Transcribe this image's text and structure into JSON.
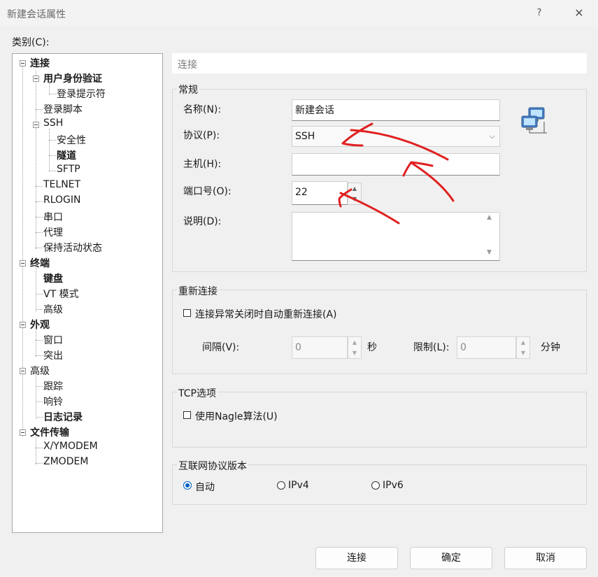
{
  "window": {
    "title": "新建会话属性",
    "help": "?",
    "close": "✕"
  },
  "category_label": "类别(C):",
  "tree": [
    {
      "label": "连接",
      "bold": true
    },
    {
      "label": "用户身份验证",
      "bold": true
    },
    {
      "label": "登录提示符",
      "bold": false
    },
    {
      "label": "登录脚本",
      "bold": false
    },
    {
      "label": "SSH",
      "bold": false
    },
    {
      "label": "安全性",
      "bold": false
    },
    {
      "label": "隧道",
      "bold": true
    },
    {
      "label": "SFTP",
      "bold": false
    },
    {
      "label": "TELNET",
      "bold": false
    },
    {
      "label": "RLOGIN",
      "bold": false
    },
    {
      "label": "串口",
      "bold": false
    },
    {
      "label": "代理",
      "bold": false
    },
    {
      "label": "保持活动状态",
      "bold": false
    },
    {
      "label": "终端",
      "bold": true
    },
    {
      "label": "键盘",
      "bold": true
    },
    {
      "label": "VT 模式",
      "bold": false
    },
    {
      "label": "高级",
      "bold": false
    },
    {
      "label": "外观",
      "bold": true
    },
    {
      "label": "窗口",
      "bold": false
    },
    {
      "label": "突出",
      "bold": false
    },
    {
      "label": "高级",
      "bold": false
    },
    {
      "label": "跟踪",
      "bold": false
    },
    {
      "label": "响铃",
      "bold": false
    },
    {
      "label": "日志记录",
      "bold": true
    },
    {
      "label": "文件传输",
      "bold": true
    },
    {
      "label": "X/YMODEM",
      "bold": false
    },
    {
      "label": "ZMODEM",
      "bold": false
    }
  ],
  "header": "连接",
  "general": {
    "title": "常规",
    "name_label": "名称(N):",
    "name_value": "新建会话",
    "protocol_label": "协议(P):",
    "protocol_value": "SSH",
    "host_label": "主机(H):",
    "host_value": "",
    "port_label": "端口号(O):",
    "port_value": "22",
    "desc_label": "说明(D):",
    "desc_value": ""
  },
  "reconnect": {
    "title": "重新连接",
    "checkbox_label": "连接异常关闭时自动重新连接(A)",
    "interval_label": "间隔(V):",
    "interval_value": "0",
    "interval_unit": "秒",
    "limit_label": "限制(L):",
    "limit_value": "0",
    "limit_unit": "分钟"
  },
  "tcp": {
    "title": "TCP选项",
    "nagle_label": "使用Nagle算法(U)"
  },
  "ip_version": {
    "title": "互联网协议版本",
    "options": [
      "自动",
      "IPv4",
      "IPv6"
    ],
    "selected": "自动"
  },
  "buttons": {
    "connect": "连接",
    "ok": "确定",
    "cancel": "取消"
  },
  "annotation_color": "#e02020"
}
